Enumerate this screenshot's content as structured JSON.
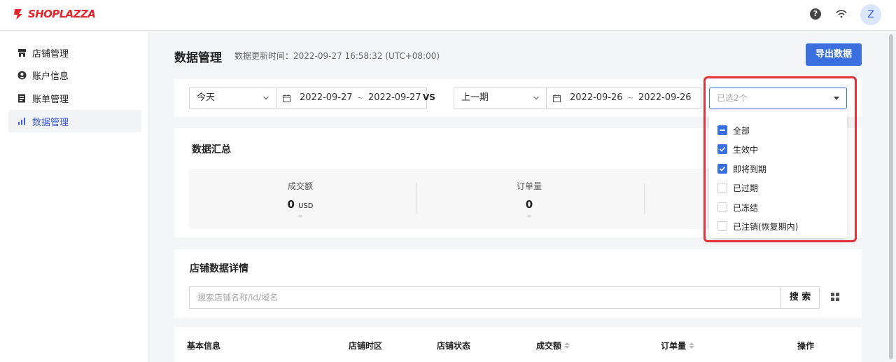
{
  "header": {
    "logo_text": "SHOPLAZZA",
    "help_icon": "question-circle-icon",
    "wifi_icon": "wifi-icon",
    "avatar_initial": "Z",
    "brand_color": "#e3262c"
  },
  "sidebar": {
    "items": [
      {
        "label": "店铺管理",
        "icon": "store-icon"
      },
      {
        "label": "账户信息",
        "icon": "user-circle-icon"
      },
      {
        "label": "账单管理",
        "icon": "bill-icon"
      },
      {
        "label": "数据管理",
        "icon": "bar-chart-icon",
        "active": true
      }
    ]
  },
  "page": {
    "title": "数据管理",
    "update_time": "数据更新时间：2022-09-27 16:58:32 (UTC+08:00)",
    "export_label": "导出数据",
    "accent_color": "#3a6fe0"
  },
  "filters": {
    "period_select": "今天",
    "range_start": "2022-09-27",
    "range_end": "2022-09-27",
    "tilde": "~",
    "vs_label": "VS",
    "compare_select": "上一期",
    "compare_start": "2022-09-26",
    "compare_end": "2022-09-26",
    "status_select_value": "已选2个"
  },
  "summary": {
    "title": "数据汇总",
    "stats": [
      {
        "label": "成交额",
        "value": "0",
        "unit": "USD",
        "change": "–"
      },
      {
        "label": "订单量",
        "value": "0",
        "unit": "",
        "change": "–"
      }
    ]
  },
  "details": {
    "title": "店铺数据详情",
    "search_placeholder": "搜索店铺名称/id/域名",
    "search_label": "搜 索",
    "grid_icon": "grid-view-icon"
  },
  "table": {
    "columns": [
      {
        "label": "基本信息",
        "sortable": false
      },
      {
        "label": "店铺时区",
        "sortable": false
      },
      {
        "label": "店铺状态",
        "sortable": false
      },
      {
        "label": "成交额",
        "sortable": true
      },
      {
        "label": "订单量",
        "sortable": true
      },
      {
        "label": "操作",
        "sortable": false
      }
    ]
  },
  "status_dropdown": {
    "options": [
      {
        "label": "全部",
        "state": "indeterminate"
      },
      {
        "label": "生效中",
        "state": "checked"
      },
      {
        "label": "即将到期",
        "state": "checked"
      },
      {
        "label": "已过期",
        "state": "unchecked"
      },
      {
        "label": "已冻结",
        "state": "unchecked"
      },
      {
        "label": "已注销(恢复期内)",
        "state": "unchecked"
      }
    ],
    "highlight_color": "#e4323c"
  }
}
